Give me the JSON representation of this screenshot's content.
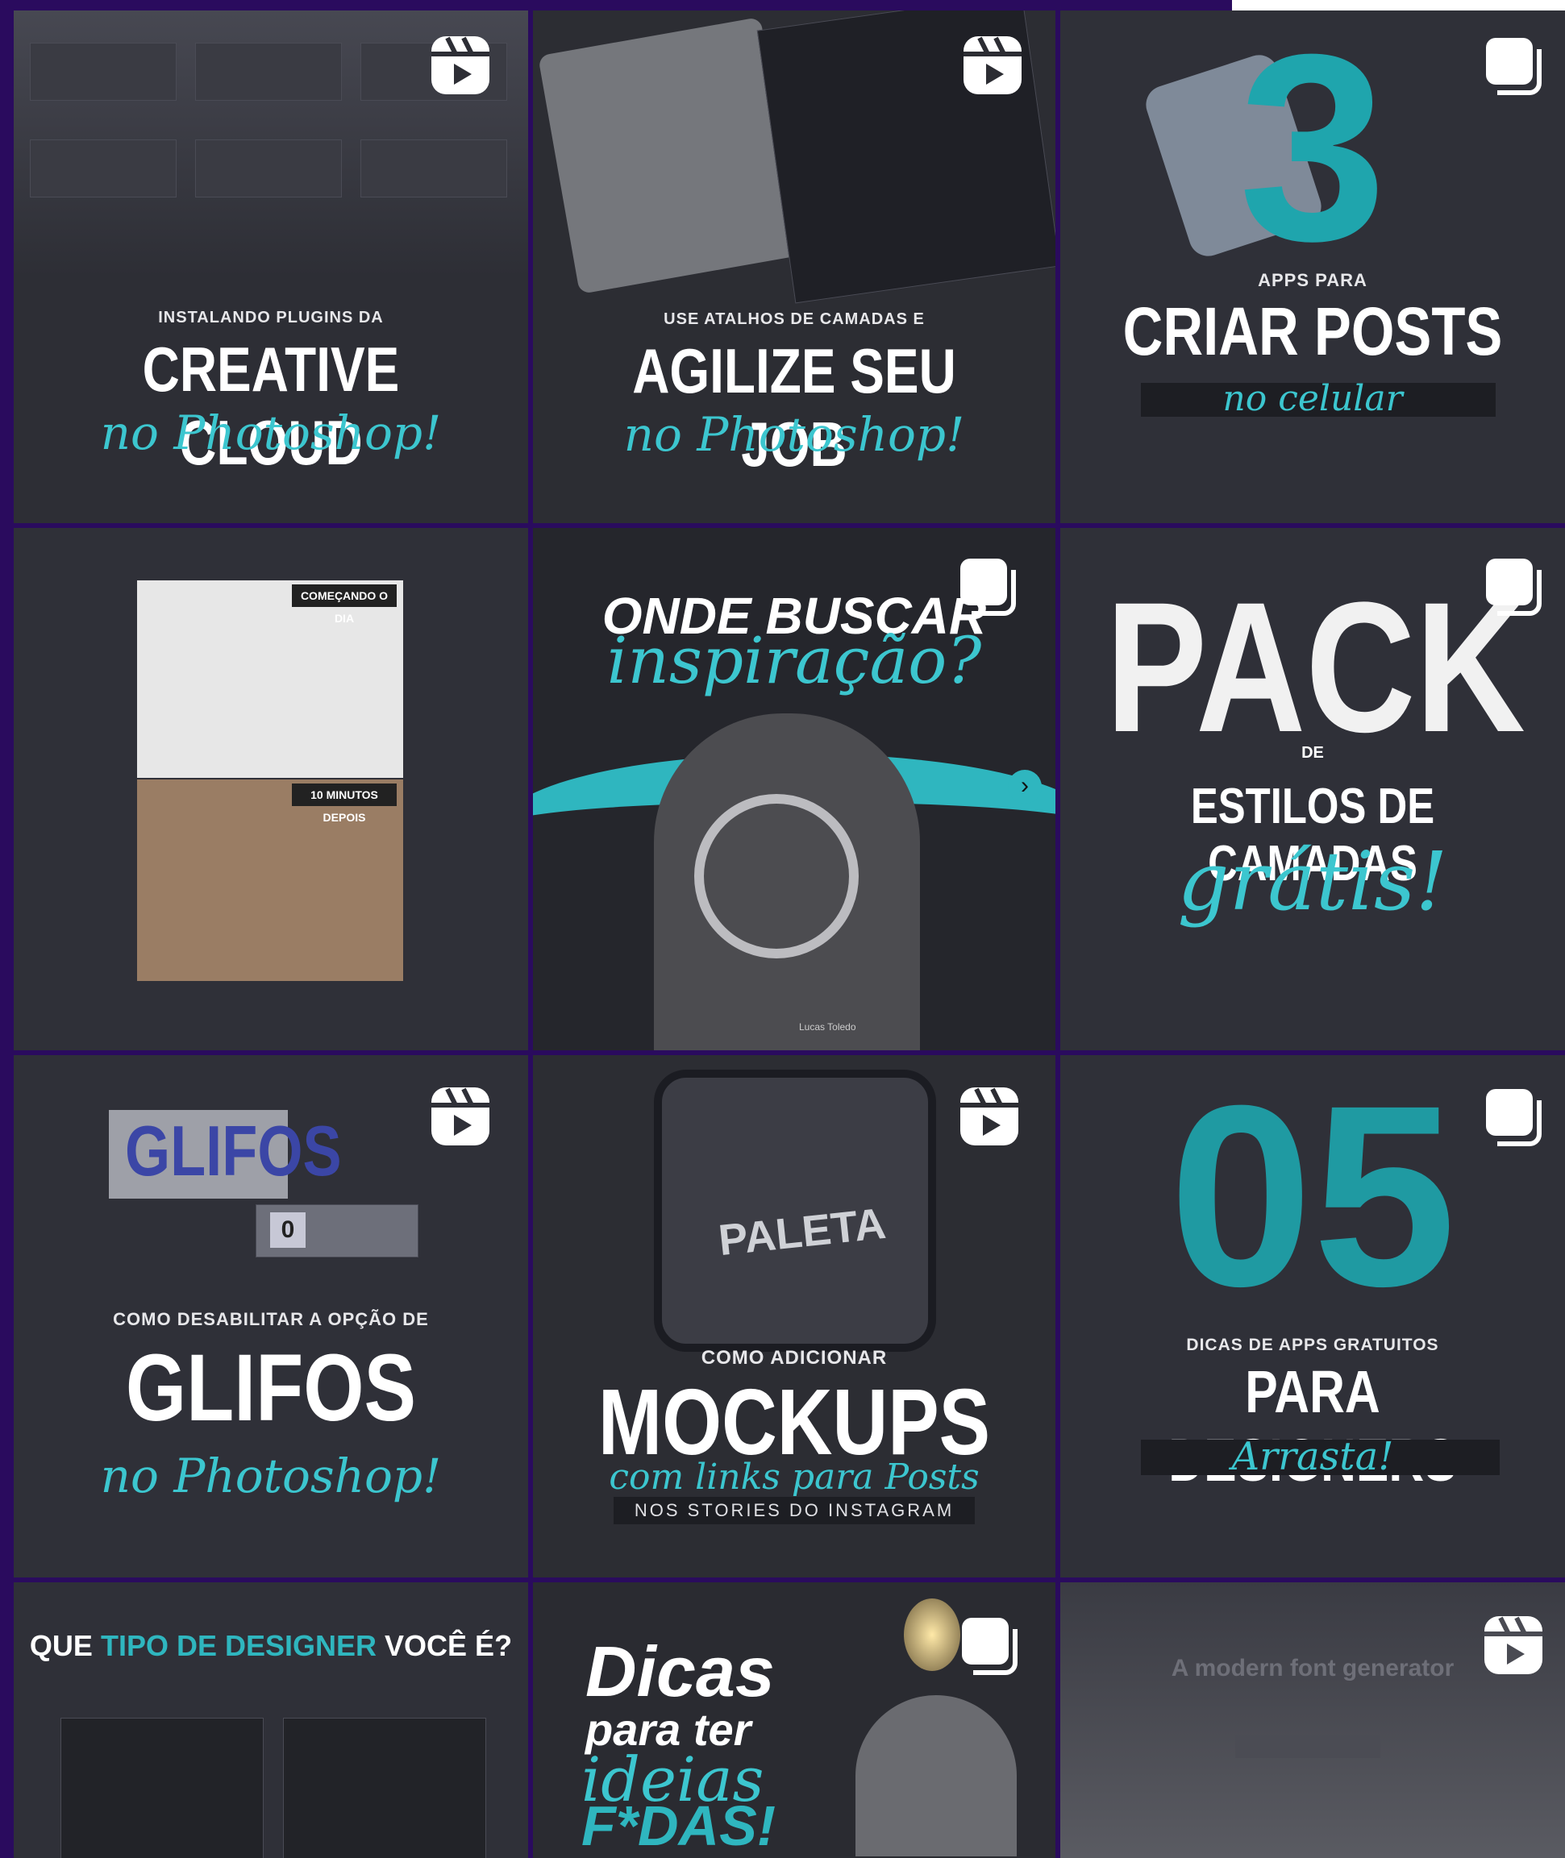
{
  "accent_teal": "#2fb6bf",
  "background_purple": "#2a0b5e",
  "icons": {
    "reel": "reel-icon",
    "carousel": "carousel-icon",
    "next": "chevron-right-icon"
  },
  "posts": [
    {
      "id": "p1",
      "kicker": "INSTALANDO PLUGINS DA",
      "headline": "CREATIVE CLOUD",
      "script": "no Photoshop!",
      "badge": "reel"
    },
    {
      "id": "p2",
      "kicker": "USE ATALHOS DE CAMADAS E",
      "headline": "AGILIZE SEU JOB",
      "script": "no Photoshop!",
      "badge": "reel"
    },
    {
      "id": "p3",
      "number": "3",
      "kicker": "APPS PARA",
      "headline": "CRIAR POSTS",
      "script": "no celular",
      "badge": "carousel"
    },
    {
      "id": "p4",
      "tag_top": "COMEÇANDO O DIA",
      "tag_bottom": "10 MINUTOS DEPOIS"
    },
    {
      "id": "p5",
      "headline": "ONDE BUSCAR",
      "script": "inspiração?",
      "badge": "carousel",
      "footer_right": "Lucas Toledo"
    },
    {
      "id": "p6",
      "headline": "PACK",
      "connector": "DE",
      "sub": "ESTILOS DE CAMADAS",
      "script": "grátis!",
      "badge": "carousel"
    },
    {
      "id": "p7",
      "big": "GLIFOS",
      "key_zero": "0",
      "kicker": "COMO DESABILITAR A OPÇÃO DE",
      "headline": "GLIFOS",
      "script": "no Photoshop!",
      "badge": "reel"
    },
    {
      "id": "p8",
      "phone_text": "PALETA",
      "kicker": "COMO ADICIONAR",
      "headline": "MOCKUPS",
      "script": "com links para Posts",
      "bar": "NOS STORIES DO INSTAGRAM",
      "badge": "reel"
    },
    {
      "id": "p9",
      "number": "05",
      "kicker": "DICAS DE APPS GRATUITOS",
      "headline": "PARA DESIGNERS",
      "script": "Arrasta!",
      "badge": "carousel"
    },
    {
      "id": "p10",
      "title_a": "QUE",
      "title_b": "TIPO DE DESIGNER",
      "title_c": "VOCÊ É?"
    },
    {
      "id": "p11",
      "line1": "Dicas",
      "line2": "para ter",
      "line3": "ideias",
      "line4": "F*DAS!",
      "badge": "carousel"
    },
    {
      "id": "p12",
      "title": "A modern font generator",
      "badge": "reel"
    }
  ]
}
